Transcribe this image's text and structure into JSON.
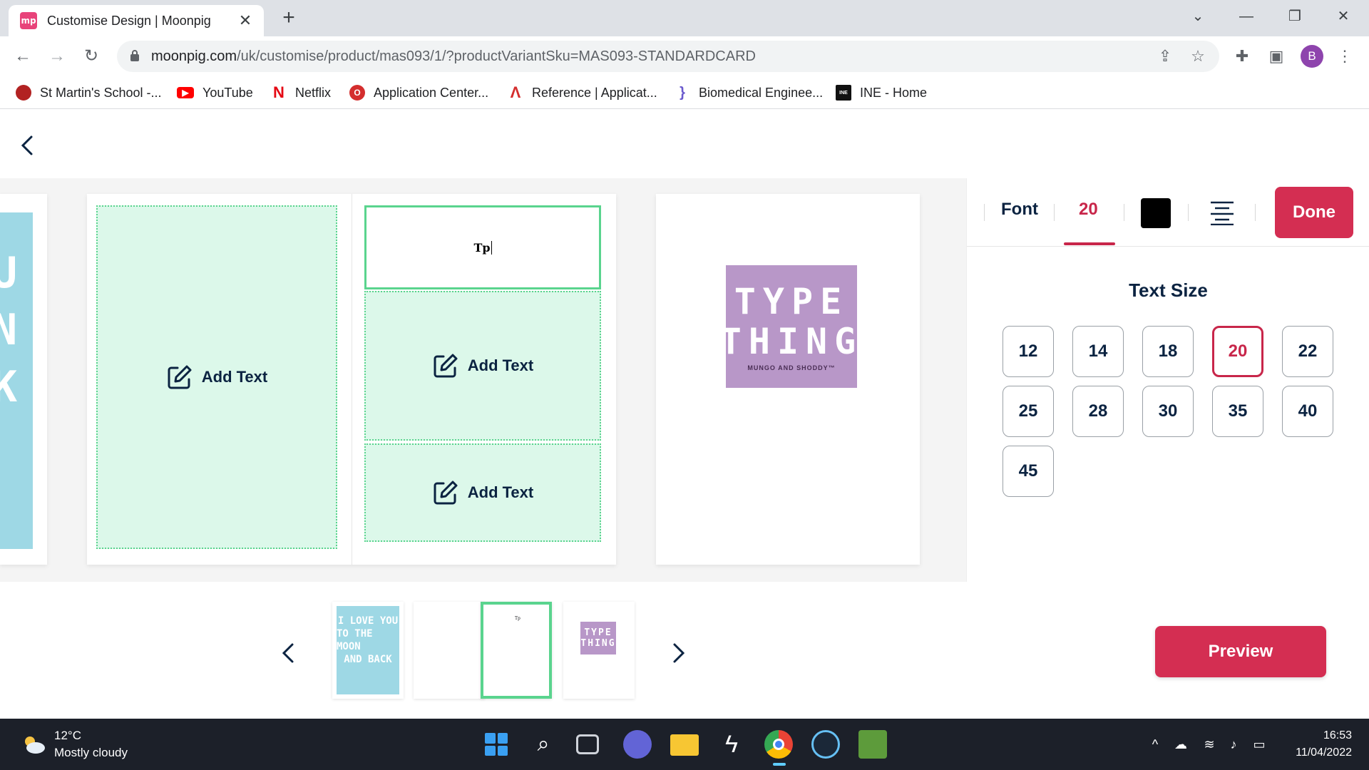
{
  "browser": {
    "tab_title": "Customise Design | Moonpig",
    "favicon_text": "mp",
    "url_domain": "moonpig.com",
    "url_path": "/uk/customise/product/mas093/1/?productVariantSku=MAS093-STANDARDCARD",
    "avatar_initial": "B",
    "bookmarks": [
      {
        "label": "St Martin's School -...",
        "icon": "school-crest-icon",
        "color": "#b22222"
      },
      {
        "label": "YouTube",
        "icon": "youtube-icon",
        "color": "#ff0000"
      },
      {
        "label": "Netflix",
        "icon": "netflix-icon",
        "color": "#e50914"
      },
      {
        "label": "Application Center...",
        "icon": "application-center-icon",
        "color": "#d42e2e"
      },
      {
        "label": "Reference | Applicat...",
        "icon": "reference-icon",
        "color": "#d42e2e"
      },
      {
        "label": "Biomedical Enginee...",
        "icon": "biomedical-icon",
        "color": "#6a5acd"
      },
      {
        "label": "INE - Home",
        "icon": "ine-icon",
        "color": "#111111"
      }
    ]
  },
  "editor": {
    "text_zones": {
      "left_panel_label": "Add Text",
      "middle_label": "Add Text",
      "bottom_label": "Add Text",
      "typed_text": "Tp"
    },
    "cover_letters": [
      "U",
      "N",
      "K"
    ],
    "logo": {
      "line1": "TYPE",
      "line2": "THING",
      "sub": "MUNGO AND SHODDY™"
    }
  },
  "panel": {
    "font_label": "Font",
    "size_value": "20",
    "text_color": "#000000",
    "done_label": "Done",
    "size_title": "Text Size",
    "sizes": [
      "12",
      "14",
      "18",
      "20",
      "22",
      "25",
      "28",
      "30",
      "35",
      "40",
      "45"
    ],
    "selected_size": "20"
  },
  "strip": {
    "thumb1_lines": [
      "I LOVE YOU",
      "TO THE MOON",
      "AND BACK"
    ],
    "thumb3_text": "Tp",
    "thumb4_lines": [
      "TYPE",
      "THING"
    ],
    "preview_label": "Preview"
  },
  "taskbar": {
    "temperature": "12°C",
    "weather": "Mostly cloudy",
    "time": "16:53",
    "date": "11/04/2022"
  },
  "colors": {
    "accent": "#d42e52",
    "zone_fill": "#dcf8ea",
    "zone_border": "#5ad48e",
    "navy": "#0b2341"
  }
}
